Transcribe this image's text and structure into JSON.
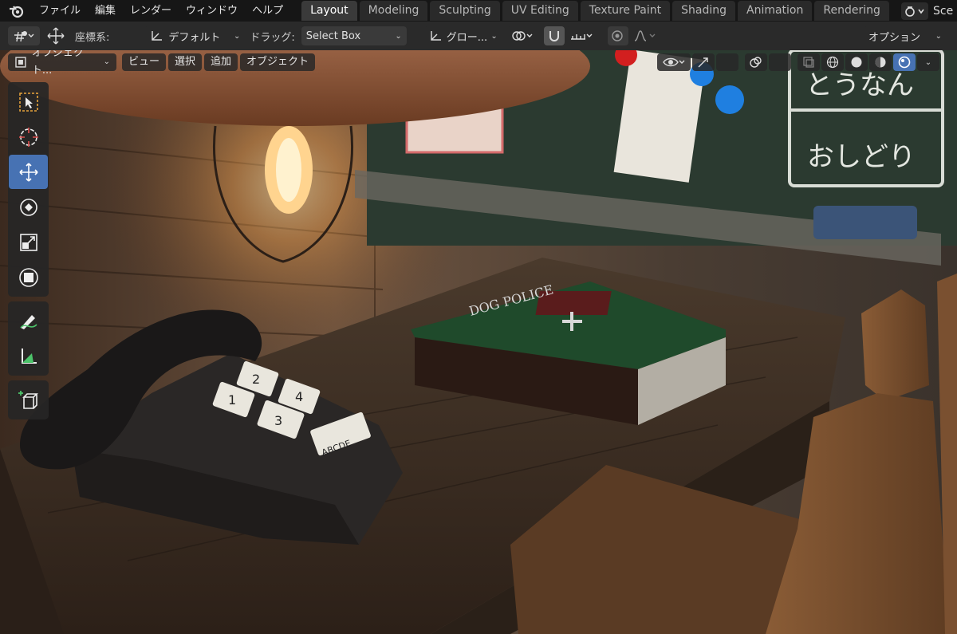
{
  "app": {
    "menu": [
      "ファイル",
      "編集",
      "レンダー",
      "ウィンドウ",
      "ヘルプ"
    ],
    "workspace_tabs": [
      "Layout",
      "Modeling",
      "Sculpting",
      "UV Editing",
      "Texture Paint",
      "Shading",
      "Animation",
      "Rendering"
    ],
    "active_tab_index": 0,
    "scene_label": "Sce"
  },
  "tool_header": {
    "orientation_label": "座標系:",
    "orientation_value": "デフォルト",
    "drag_label": "ドラッグ:",
    "drag_value": "Select Box",
    "transform_orientation_value": "グロー...",
    "options_label": "オプション"
  },
  "viewport_header": {
    "mode_value": "オブジェクト...",
    "menus": [
      "ビュー",
      "選択",
      "追加",
      "オブジェクト"
    ]
  },
  "tools": [
    {
      "name": "select-box-tool",
      "icon": "select-box-icon",
      "active": false,
      "group": 1
    },
    {
      "name": "cursor-tool",
      "icon": "cursor-icon",
      "active": false,
      "group": 1
    },
    {
      "name": "move-tool",
      "icon": "move-icon",
      "active": true,
      "group": 1
    },
    {
      "name": "rotate-tool",
      "icon": "rotate-icon",
      "active": false,
      "group": 1
    },
    {
      "name": "scale-tool",
      "icon": "scale-icon",
      "active": false,
      "group": 1
    },
    {
      "name": "transform-tool",
      "icon": "transform-icon",
      "active": false,
      "group": 1
    },
    {
      "name": "annotate-tool",
      "icon": "annotate-icon",
      "active": false,
      "group": 2
    },
    {
      "name": "measure-tool",
      "icon": "measure-icon",
      "active": false,
      "group": 2
    },
    {
      "name": "add-cube-tool",
      "icon": "add-cube-icon",
      "active": false,
      "group": 3
    }
  ],
  "scene": {
    "book_title": "DOG POLICE",
    "phone_keys": [
      "1",
      "2",
      "3",
      "4",
      "ABCDE"
    ],
    "blackboard_text": [
      "とうなん",
      "おしどり"
    ],
    "accent_color": "#4772b3"
  }
}
